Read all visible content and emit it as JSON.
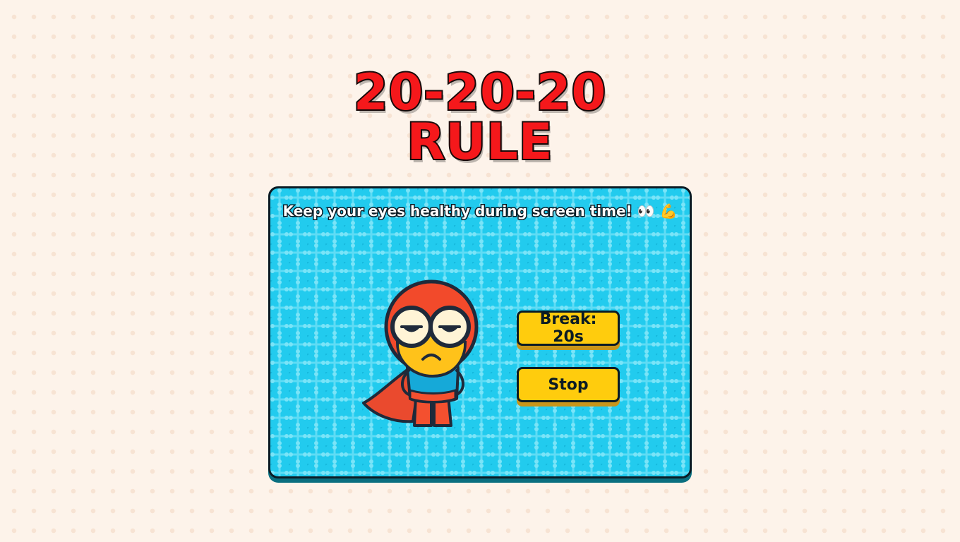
{
  "title": {
    "line1": "20-20-20",
    "line2": "RULE"
  },
  "card": {
    "tagline": "Keep your eyes healthy during screen time! 👀 💪",
    "break_button_label": "Break: 20s",
    "stop_button_label": "Stop"
  },
  "colors": {
    "page_background": "#fdf3ea",
    "title_red": "#f5181b",
    "card_cyan": "#22cbee",
    "button_yellow": "#ffcc0d",
    "mascot_red": "#f24a2b"
  },
  "mascot": {
    "icon": "superhero-mascot-icon",
    "mood": "tired"
  }
}
